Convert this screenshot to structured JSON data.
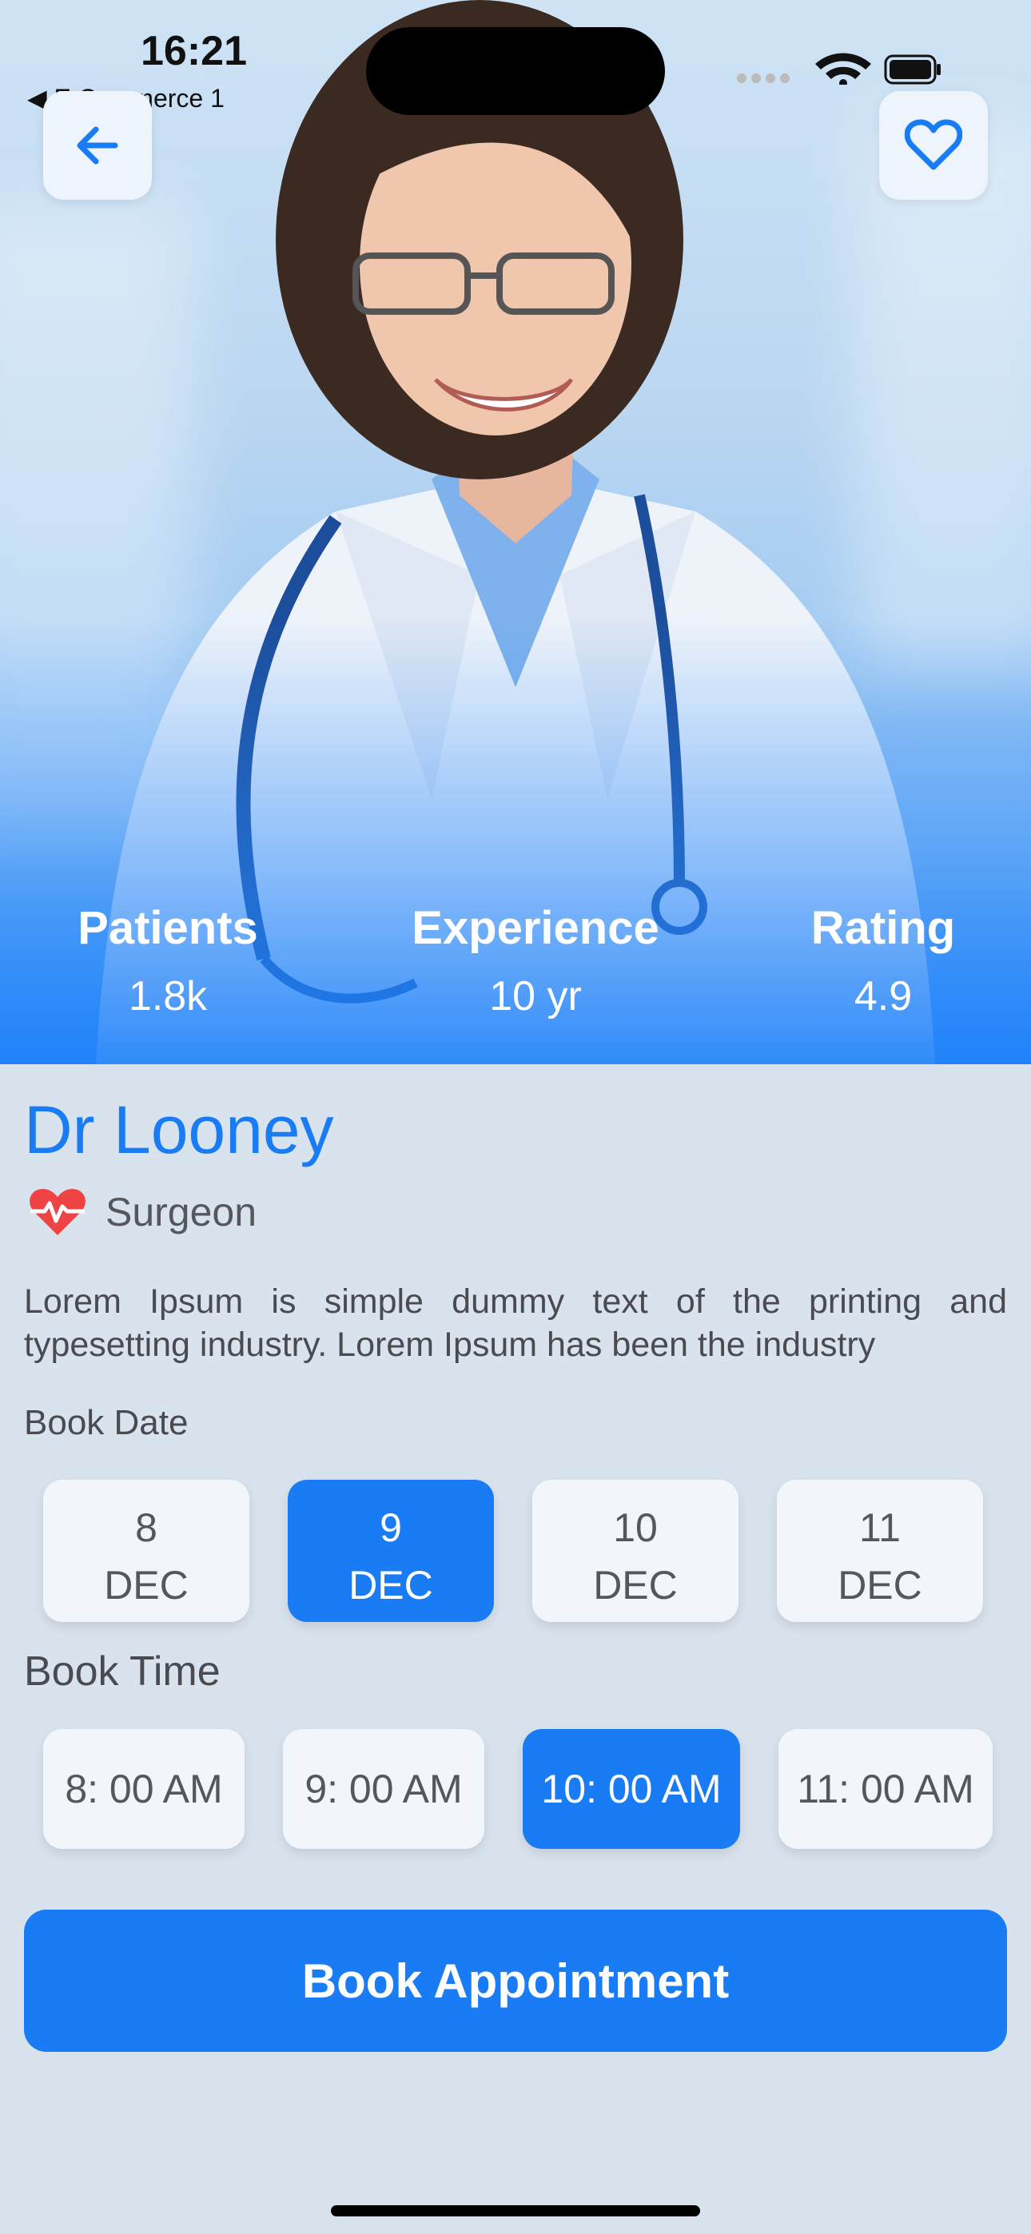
{
  "status_bar": {
    "time": "16:21",
    "back_app": "◀ E Commerce 1"
  },
  "icons": {
    "back": "arrow-left-icon",
    "favorite": "heart-outline-icon",
    "specialty": "heart-pulse-icon"
  },
  "stats": [
    {
      "label": "Patients",
      "value": "1.8k"
    },
    {
      "label": "Experience",
      "value": "10 yr"
    },
    {
      "label": "Rating",
      "value": "4.9"
    }
  ],
  "doctor": {
    "name": "Dr Looney",
    "specialty": "Surgeon",
    "description": "Lorem Ipsum is simple dummy text of the printing and typesetting industry. Lorem Ipsum has been the industry"
  },
  "book_date": {
    "label": "Book Date",
    "dates": [
      {
        "day": "8",
        "month": "DEC",
        "selected": false
      },
      {
        "day": "9",
        "month": "DEC",
        "selected": true
      },
      {
        "day": "10",
        "month": "DEC",
        "selected": false
      },
      {
        "day": "11",
        "month": "DEC",
        "selected": false
      }
    ]
  },
  "book_time": {
    "label": "Book Time",
    "times": [
      {
        "label": "8: 00 AM",
        "selected": false
      },
      {
        "label": "9: 00 AM",
        "selected": false
      },
      {
        "label": "10: 00 AM",
        "selected": true
      },
      {
        "label": "11: 00 AM",
        "selected": false
      }
    ]
  },
  "cta": {
    "label": "Book Appointment"
  },
  "colors": {
    "accent": "#1a7cf5",
    "background": "#d9e3ee",
    "card": "#f2f6fb",
    "heart": "#ef4444"
  }
}
